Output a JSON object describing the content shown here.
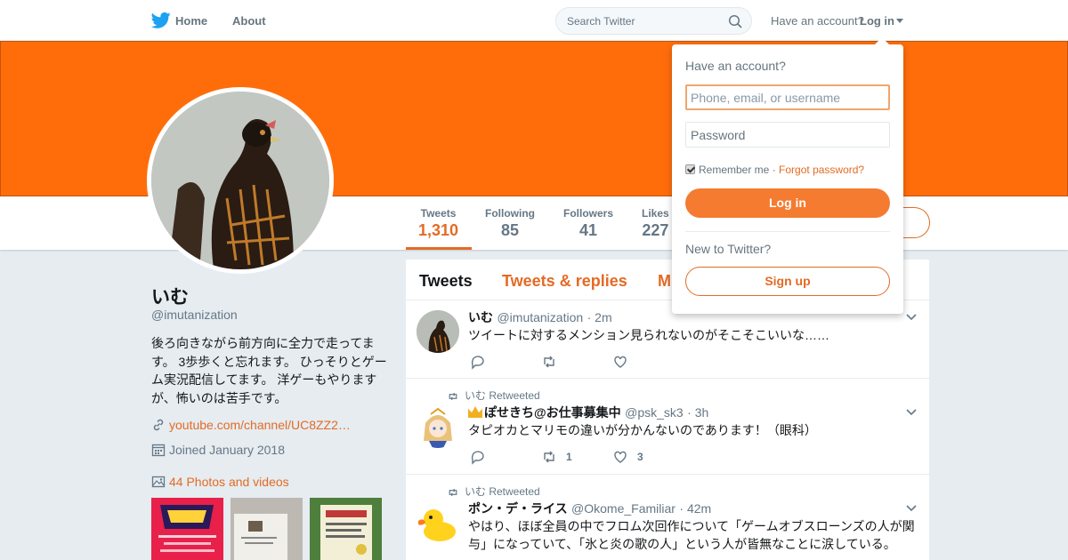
{
  "header": {
    "home_label": "Home",
    "about_label": "About",
    "search_placeholder": "Search Twitter",
    "have_account": "Have an account?",
    "login_label": "Log in"
  },
  "profile": {
    "name": "いむ",
    "handle": "@imutanization",
    "bio": "後ろ向きながら前方向に全力で走ってます。 3歩歩くと忘れます。 ひっそりとゲーム実況配信してます。 洋ゲーもやりますが、怖いのは苦手です。",
    "url": "youtube.com/channel/UC8ZZ2…",
    "joined": "Joined January 2018",
    "photos_label": "44 Photos and videos"
  },
  "stats": [
    {
      "label": "Tweets",
      "value": "1,310"
    },
    {
      "label": "Following",
      "value": "85"
    },
    {
      "label": "Followers",
      "value": "41"
    },
    {
      "label": "Likes",
      "value": "227"
    }
  ],
  "tabs": [
    "Tweets",
    "Tweets & replies",
    "M"
  ],
  "tweets": [
    {
      "retweet_by": "",
      "name": "いむ",
      "handle": "@imutanization",
      "time": "· 2m",
      "text": "ツイートに対するメンション見られないのがそこそこいいな……",
      "retweets": "",
      "likes": ""
    },
    {
      "retweet_by": "いむ Retweeted",
      "name": "ぽせきち@お仕事募集中",
      "handle": "@psk_sk3",
      "time": "· 3h",
      "text": "タピオカとマリモの違いが分かんないのであります！（眼科）",
      "retweets": "1",
      "likes": "3"
    },
    {
      "retweet_by": "いむ Retweeted",
      "name": "ポン・デ・ライス",
      "handle": "@Okome_Familiar",
      "time": "· 42m",
      "text": "やはり、ほぼ全員の中でフロム次回作について「ゲームオブスローンズの人が関与」になっていて、「氷と炎の歌の人」という人が皆無なことに涙している。",
      "retweets": "",
      "likes": ""
    }
  ],
  "login_dropdown": {
    "title": "Have an account?",
    "username_placeholder": "Phone, email, or username",
    "password_placeholder": "Password",
    "remember_me": "Remember me",
    "separator": "·",
    "forgot": "Forgot password?",
    "login_button": "Log in",
    "new_to": "New to Twitter?",
    "signup_button": "Sign up"
  },
  "colors": {
    "accent": "#e36b25",
    "banner": "#ff6d0b",
    "twitter_blue": "#1da1f2",
    "page_bg": "#e6ecf0"
  }
}
